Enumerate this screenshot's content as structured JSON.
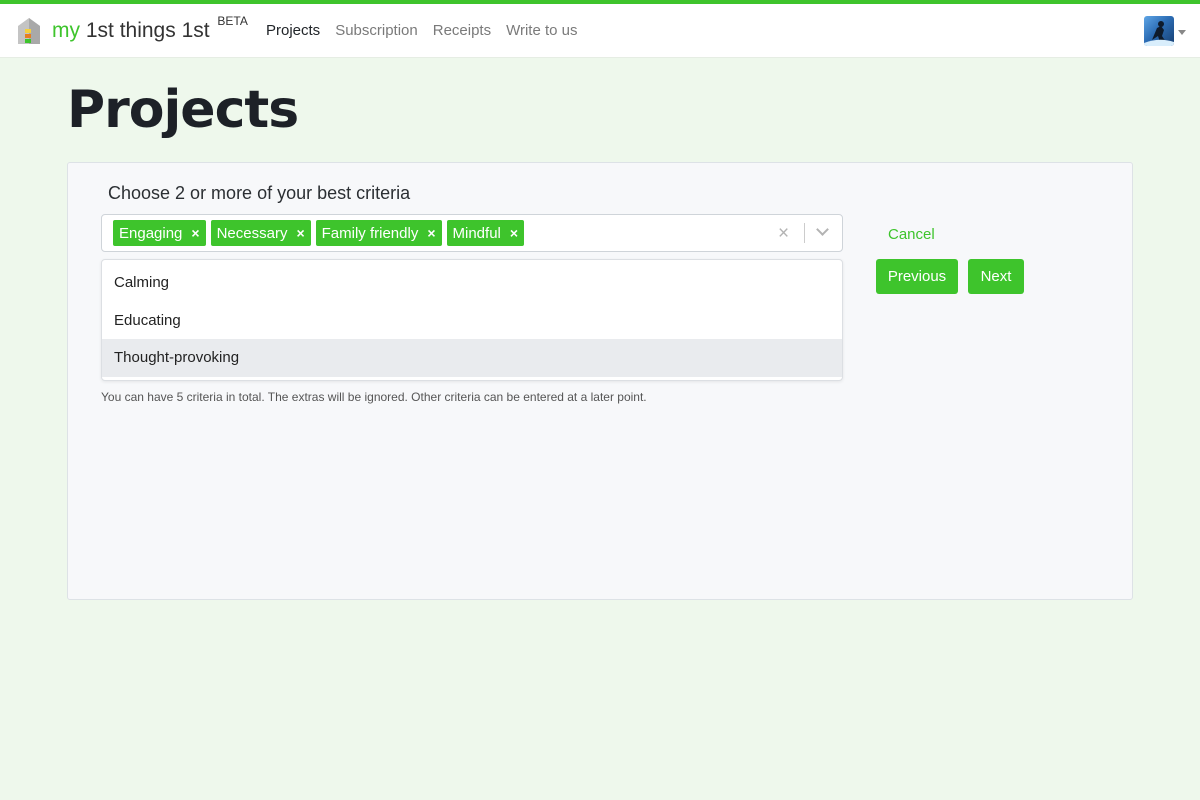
{
  "brand": {
    "my": "my",
    "name": "1st things 1st",
    "badge": "BETA"
  },
  "nav": {
    "items": [
      {
        "label": "Projects",
        "active": true
      },
      {
        "label": "Subscription",
        "active": false
      },
      {
        "label": "Receipts",
        "active": false
      },
      {
        "label": "Write to us",
        "active": false
      }
    ]
  },
  "page": {
    "title": "Projects"
  },
  "form": {
    "label": "Choose 2 or more of your best criteria",
    "selected": [
      "Engaging",
      "Necessary",
      "Family friendly",
      "Mindful"
    ],
    "remove_glyph": "×",
    "clear_glyph": "×",
    "options": [
      "Calming",
      "Educating",
      "Thought-provoking"
    ],
    "highlighted_option": "Thought-provoking",
    "helper": "You can have 5 criteria in total. The extras will be ignored. Other criteria can be entered at a later point."
  },
  "actions": {
    "cancel": "Cancel",
    "previous": "Previous",
    "next": "Next"
  },
  "colors": {
    "accent": "#3ec42c",
    "background": "#eef8ec",
    "card": "#f7f8fa"
  },
  "icons": {
    "logo": "house-logo-icon",
    "avatar": "user-avatar",
    "caret": "caret-down-icon",
    "clear": "clear-icon",
    "dropdown": "chevron-down-icon"
  }
}
